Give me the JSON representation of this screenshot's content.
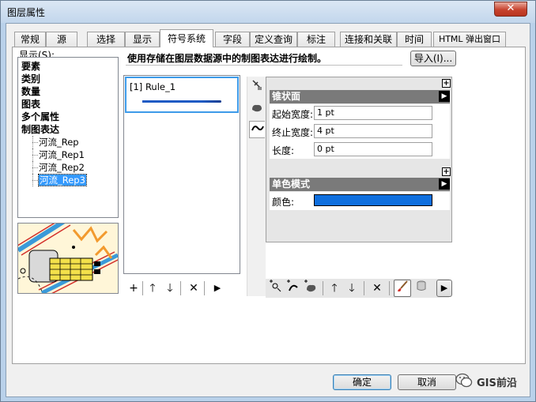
{
  "window": {
    "title": "图层属性",
    "close_glyph": "✕"
  },
  "tabs": [
    "常规",
    "源",
    "选择",
    "显示",
    "符号系统",
    "字段",
    "定义查询",
    "标注",
    "连接和关联",
    "时间",
    "HTML 弹出窗口"
  ],
  "active_tab": "符号系统",
  "show_label": "显示(S):",
  "tree": {
    "categories": [
      "要素",
      "类别",
      "数量",
      "图表",
      "多个属性",
      "制图表达"
    ],
    "representations": [
      "河流_Rep",
      "河流_Rep1",
      "河流_Rep2",
      "河流_Rep3"
    ],
    "selected": "河流_Rep3"
  },
  "description": "使用存储在图层数据源中的制图表达进行绘制。",
  "import_button": "导入(I)...",
  "rules": [
    {
      "label": "[1] Rule_1"
    }
  ],
  "properties": {
    "section1_title": "锥状面",
    "start_width_label": "起始宽度:",
    "start_width_value": "1 pt",
    "end_width_label": "终止宽度:",
    "end_width_value": "4 pt",
    "length_label": "长度:",
    "length_value": "0 pt",
    "section2_title": "单色模式",
    "color_label": "颜色:",
    "color_value": "#0f6fde"
  },
  "left_toolbar": {
    "add_glyph": "+",
    "up_glyph": "🡑",
    "down_glyph": "🡓",
    "delete_glyph": "✕",
    "more_glyph": "▶"
  },
  "right_toolbar": {
    "up_glyph": "🡑",
    "down_glyph": "🡓",
    "delete_glyph": "✕",
    "more_glyph": "▶"
  },
  "buttons": {
    "ok": "确定",
    "cancel": "取消"
  },
  "watermark": {
    "text": "GIS前沿"
  },
  "colors": {
    "accent": "#3399ff",
    "section_header": "#7a7a7a",
    "stroke_blue": "#1f5bc4"
  }
}
